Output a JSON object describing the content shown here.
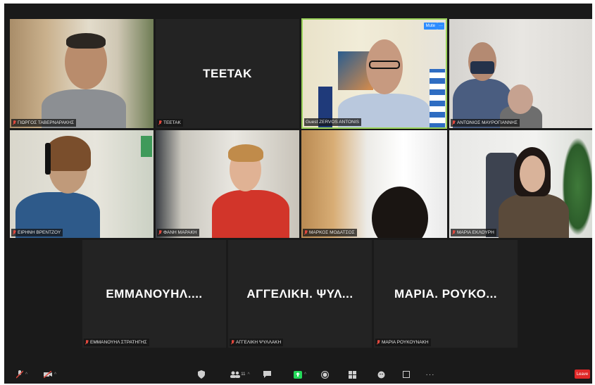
{
  "participants": [
    {
      "name_label": "ΓΙΩΡΓΟΣ ΤΑΒΕΡΝΑΡΑΚΗΣ",
      "video": true
    },
    {
      "name_label": "ΤΕΕΤΑΚ",
      "big_name": "ΤΕΕΤΑΚ",
      "video": false
    },
    {
      "name_label": "Guest ZERVOS ANTONIS",
      "video": true,
      "active_speaker": true,
      "mute_label": "Mute",
      "more_label": "···"
    },
    {
      "name_label": "ΑΝΤΩΝΙΟΣ ΜΑΥΡΟΓΙΑΝΝΗΣ",
      "video": true
    },
    {
      "name_label": "ΕΙΡΗΝΗ ΒΡΕΝΤΖΟΥ",
      "video": true
    },
    {
      "name_label": "ΦΑΝΗ ΜΑΡΑΚΗ",
      "video": true
    },
    {
      "name_label": "ΜΑΡΚΟΣ ΜΟΔΑΤΣΟΣ",
      "video": true
    },
    {
      "name_label": "ΜΑΡΙΑ ΕΚΛΟΥΡΗ",
      "video": true
    },
    {
      "name_label": "ΕΜΜΑΝΟΥΗΛ ΣΤΡΑΤΗΓΗΣ",
      "big_name": "ΕΜΜΑΝΟΥΗΛ....",
      "video": false
    },
    {
      "name_label": "ΑΓΓΕΛΙΚΗ ΨΥΛΛΑΚΗ",
      "big_name": "ΑΓΓΕΛΙΚΗ. ΨΥΛ...",
      "video": false
    },
    {
      "name_label": "ΜΑΡΙΑ ΡΟΥΚΟΥΝΑΚΗ",
      "big_name": "ΜΑΡΙΑ. ΡΟΥΚΟ...",
      "video": false
    }
  ],
  "toolbar": {
    "participants_count": "11",
    "leave_label": "Leave",
    "icons": [
      "mic-muted-icon",
      "video-off-icon",
      "security-icon",
      "participants-icon",
      "chat-icon",
      "share-screen-icon",
      "record-icon",
      "breakout-icon",
      "reactions-icon",
      "apps-icon",
      "more-icon"
    ]
  },
  "colors": {
    "active_speaker_border": "#9bd35a",
    "mute_button": "#2d8cff",
    "leave_button": "#e02828",
    "share_green": "#23d959"
  }
}
